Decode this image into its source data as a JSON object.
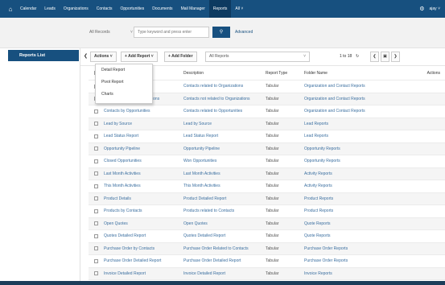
{
  "nav": {
    "items": [
      "Calendar",
      "Leads",
      "Organizations",
      "Contacts",
      "Opportunities",
      "Documents",
      "Mail Manager",
      "Reports",
      "All"
    ],
    "active": "Reports",
    "user": "ajay"
  },
  "search": {
    "records_select": "All Records",
    "placeholder": "Type keyword and press enter",
    "advanced_label": "Advanced"
  },
  "sidebar": {
    "reports_list_label": "Reports List"
  },
  "toolbar": {
    "actions_label": "Actions",
    "add_report_label": "+ Add Report",
    "add_folder_label": "+ Add Folder",
    "filter_value": "All Reports",
    "pagination": "1 to 18"
  },
  "dropdown": {
    "options": [
      "Detail Report",
      "Pivot Report",
      "Charts"
    ]
  },
  "table": {
    "headers": [
      "Report Name",
      "Description",
      "Report Type",
      "Folder Name",
      "Actions"
    ],
    "rows": [
      {
        "name": "Contacts by Organizations",
        "description": "Contacts related to Organizations",
        "type": "Tabular",
        "folder": "Organization and Contact Reports"
      },
      {
        "name": "Contacts without Organizations",
        "description": "Contacts not related to Organizations",
        "type": "Tabular",
        "folder": "Organization and Contact Reports"
      },
      {
        "name": "Contacts by Opportunities",
        "description": "Contacts related to Opportunities",
        "type": "Tabular",
        "folder": "Organization and Contact Reports"
      },
      {
        "name": "Lead by Source",
        "description": "Lead by Source",
        "type": "Tabular",
        "folder": "Lead Reports"
      },
      {
        "name": "Lead Status Report",
        "description": "Lead Status Report",
        "type": "Tabular",
        "folder": "Lead Reports"
      },
      {
        "name": "Opportunity Pipeline",
        "description": "Opportunity Pipeline",
        "type": "Tabular",
        "folder": "Opportunity Reports"
      },
      {
        "name": "Closed Opportunities",
        "description": "Won Opportunities",
        "type": "Tabular",
        "folder": "Opportunity Reports"
      },
      {
        "name": "Last Month Activities",
        "description": "Last Month Activities",
        "type": "Tabular",
        "folder": "Activity Reports"
      },
      {
        "name": "This Month Activities",
        "description": "This Month Activities",
        "type": "Tabular",
        "folder": "Activity Reports"
      },
      {
        "name": "Product Details",
        "description": "Product Detailed Report",
        "type": "Tabular",
        "folder": "Product Reports"
      },
      {
        "name": "Products by Contacts",
        "description": "Products related to Contacts",
        "type": "Tabular",
        "folder": "Product Reports"
      },
      {
        "name": "Open Quotes",
        "description": "Open Quotes",
        "type": "Tabular",
        "folder": "Quote Reports"
      },
      {
        "name": "Quotes Detailed Report",
        "description": "Quotes Detailed Report",
        "type": "Tabular",
        "folder": "Quote Reports"
      },
      {
        "name": "Purchase Order by Contacts",
        "description": "Purchase Order Related to Contacts",
        "type": "Tabular",
        "folder": "Purchase Order Reports"
      },
      {
        "name": "Purchase Order Detailed Report",
        "description": "Purchase Order Detailed Report",
        "type": "Tabular",
        "folder": "Purchase Order Reports"
      },
      {
        "name": "Invoice Detailed Report",
        "description": "Invoice Detailed Report",
        "type": "Tabular",
        "folder": "Invoice Reports"
      }
    ]
  },
  "colors": {
    "brand": "#17507f",
    "link": "#3b6fa0"
  }
}
